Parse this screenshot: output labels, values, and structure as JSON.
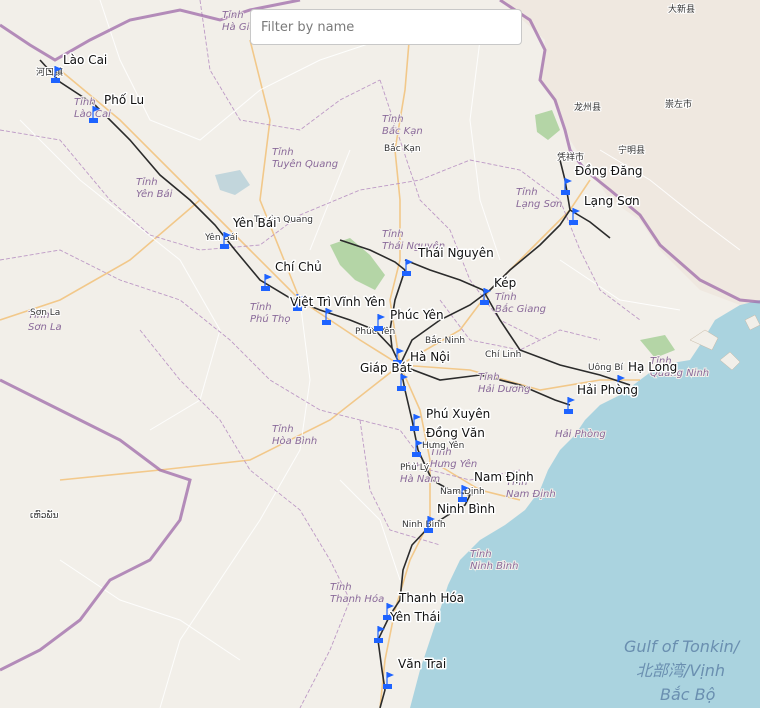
{
  "search": {
    "placeholder": "Filter by name"
  },
  "colors": {
    "land": "#f2efe9",
    "sea": "#aad3df",
    "border": "#9e6aa8",
    "railway": "#2b2b2b",
    "road_major": "#f3c27a",
    "road_minor": "#ffffff",
    "forest": "#add19e",
    "marker": "#1e63ff"
  },
  "stations": [
    {
      "name": "Lào Cai"
    },
    {
      "name": "Phố Lu"
    },
    {
      "name": "Yên Bái"
    },
    {
      "name": "Chí Chủ"
    },
    {
      "name": "Việt Trì"
    },
    {
      "name": "Vĩnh Yên"
    },
    {
      "name": "Phúc Yên"
    },
    {
      "name": "Thái Nguyên"
    },
    {
      "name": "Kép"
    },
    {
      "name": "Đồng Đăng"
    },
    {
      "name": "Lạng Sơn"
    },
    {
      "name": "Hà Nội"
    },
    {
      "name": "Giáp Bát"
    },
    {
      "name": "Hạ Long"
    },
    {
      "name": "Hải Phòng"
    },
    {
      "name": "Phú Xuyên"
    },
    {
      "name": "Đồng Văn"
    },
    {
      "name": "Nam Định"
    },
    {
      "name": "Ninh Bình"
    },
    {
      "name": "Thanh Hóa"
    },
    {
      "name": "Yên Thái"
    },
    {
      "name": "Văn Trai"
    }
  ],
  "regions": [
    {
      "name": "Tỉnh Hà Giang"
    },
    {
      "name": "Tỉnh Lào Cai"
    },
    {
      "name": "Tỉnh Tuyên Quang"
    },
    {
      "name": "Tỉnh Bắc Kạn"
    },
    {
      "name": "Tỉnh Yên Bái"
    },
    {
      "name": "Tỉnh Lạng Sơn"
    },
    {
      "name": "Tỉnh Thái Nguyên"
    },
    {
      "name": "Tỉnh Phú Thọ"
    },
    {
      "name": "Tỉnh Bắc Giang"
    },
    {
      "name": "Tỉnh Sơn La"
    },
    {
      "name": "Tỉnh Hòa Bình"
    },
    {
      "name": "Tỉnh Hải Dương"
    },
    {
      "name": "Tỉnh Quảng Ninh"
    },
    {
      "name": "Tỉnh Hưng Yên"
    },
    {
      "name": "Tỉnh Hà Nam"
    },
    {
      "name": "Tỉnh Ninh Bình"
    },
    {
      "name": "Tỉnh Nam Định"
    },
    {
      "name": "Tỉnh Thanh Hóa"
    },
    {
      "name": "Hải Phòng"
    }
  ],
  "towns": [
    {
      "name": "河口镇"
    },
    {
      "name": "Bắc Kạn"
    },
    {
      "name": "凭祥市"
    },
    {
      "name": "宁明县"
    },
    {
      "name": "龙州县"
    },
    {
      "name": "崇左市"
    },
    {
      "name": "大新县"
    },
    {
      "name": "Tuyên Quang"
    },
    {
      "name": "Yên Bái"
    },
    {
      "name": "Sơn La"
    },
    {
      "name": "Phúc Yên"
    },
    {
      "name": "Bắc Ninh"
    },
    {
      "name": "Chí Linh"
    },
    {
      "name": "Uông Bí"
    },
    {
      "name": "Hưng Yên"
    },
    {
      "name": "Phủ Lý"
    },
    {
      "name": "Nam Định"
    },
    {
      "name": "Ninh Bình"
    },
    {
      "name": "ເຫົວພັນ"
    }
  ],
  "sea": {
    "name_vi": "Gulf of Tonkin/",
    "name_zh": "北部湾/Vịnh",
    "name_vi2": "Bắc Bộ"
  }
}
